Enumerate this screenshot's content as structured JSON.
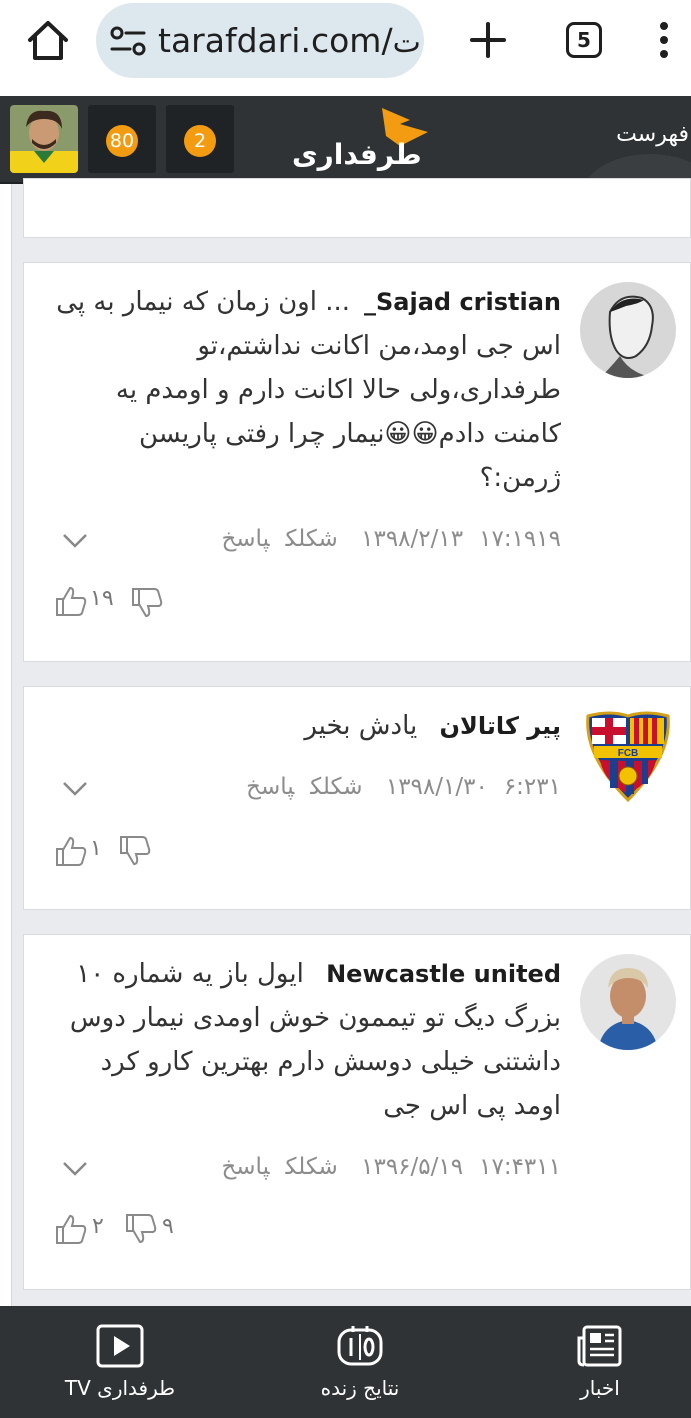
{
  "browser": {
    "url": "tarafdari.com/",
    "url_suffix": "ت",
    "tab_count": "5"
  },
  "header": {
    "logo_text": "طرفداری",
    "points_count": "80",
    "notification_count": "2",
    "menu_label": "فهرست"
  },
  "comments": [
    {
      "author": "Sajad cristian_",
      "author_suffix": "...",
      "text": "اون زمان که نیمار به پی اس جی اومد،من اکانت نداشتم،تو طرفداری،ولی حالا اکانت دارم و اومدم یه کامنت دادم😀😀نیمار چرا رفتی پاریسن ژرمن:؟",
      "date": "۱۳۹۸/۲/۱۳",
      "time": "۱۷:۱۹",
      "likes_label": "۱۹ شکلک",
      "reply_label": "پاسخ",
      "upvotes": "۱۹",
      "downvotes": ""
    },
    {
      "author": "پیر کاتالان",
      "text": "یادش بخیر",
      "date": "۱۳۹۸/۱/۳۰",
      "time": "۶:۲۳",
      "likes_label": "۱ شکلک",
      "reply_label": "پاسخ",
      "upvotes": "۱",
      "downvotes": ""
    },
    {
      "author": "Newcastle united",
      "text": "ایول باز یه شماره ۱۰ بزرگ دیگ تو تیممون خوش اومدی نیمار دوس داشتنی خیلی دوسش دارم بهترین کارو کرد اومد پی اس جی",
      "date": "۱۳۹۶/۵/۱۹",
      "time": "۱۷:۴۳",
      "likes_label": "۱۱ شکلک",
      "reply_label": "پاسخ",
      "upvotes": "۲",
      "downvotes": "۹"
    }
  ],
  "bottom_nav": [
    {
      "label": "طرفداری TV",
      "icon": "play-icon"
    },
    {
      "label": "نتایج زنده",
      "icon": "scoreboard-icon"
    },
    {
      "label": "اخبار",
      "icon": "newspaper-icon"
    }
  ],
  "colors": {
    "header_bg": "#2f3336",
    "accent": "#f39c12",
    "feed_bg": "#e9ebee"
  }
}
